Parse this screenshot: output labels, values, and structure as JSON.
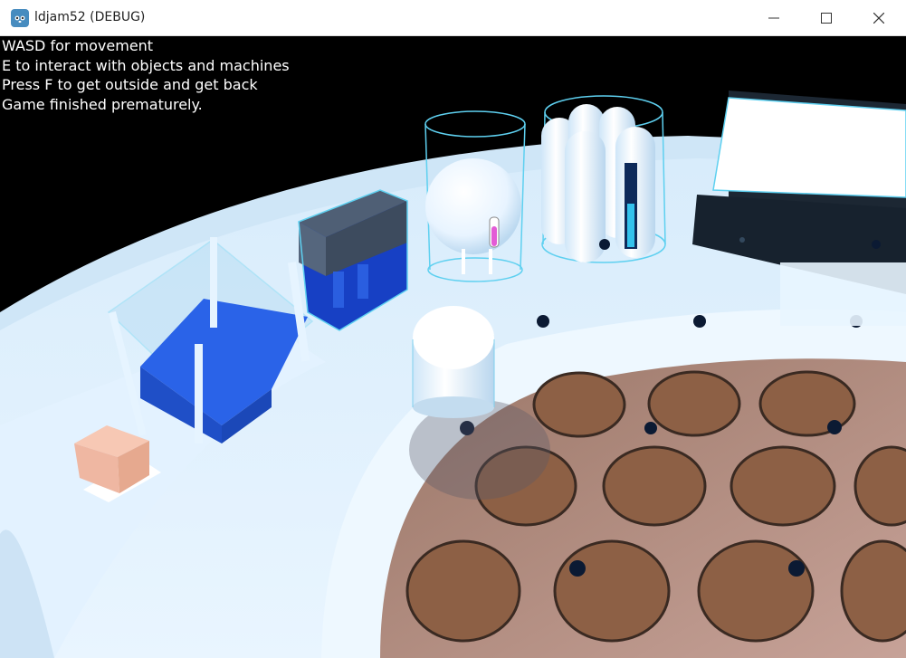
{
  "window": {
    "title": "ldjam52 (DEBUG)",
    "icon": "godot-engine-icon",
    "controls": [
      "minimize-icon",
      "maximize-icon",
      "close-icon"
    ]
  },
  "hud": {
    "lines": [
      "WASD for movement",
      "E to interact with objects and machines",
      "Press F to get outside and get back",
      "Game finished prematurely."
    ]
  },
  "colors": {
    "sky": "#000000",
    "hull": "#dcefff",
    "floor": "#b08a7c",
    "pot_soil": "#8b5e43",
    "glass_cyan": "#5ed0f0",
    "blue_container": "#2a63e8"
  }
}
